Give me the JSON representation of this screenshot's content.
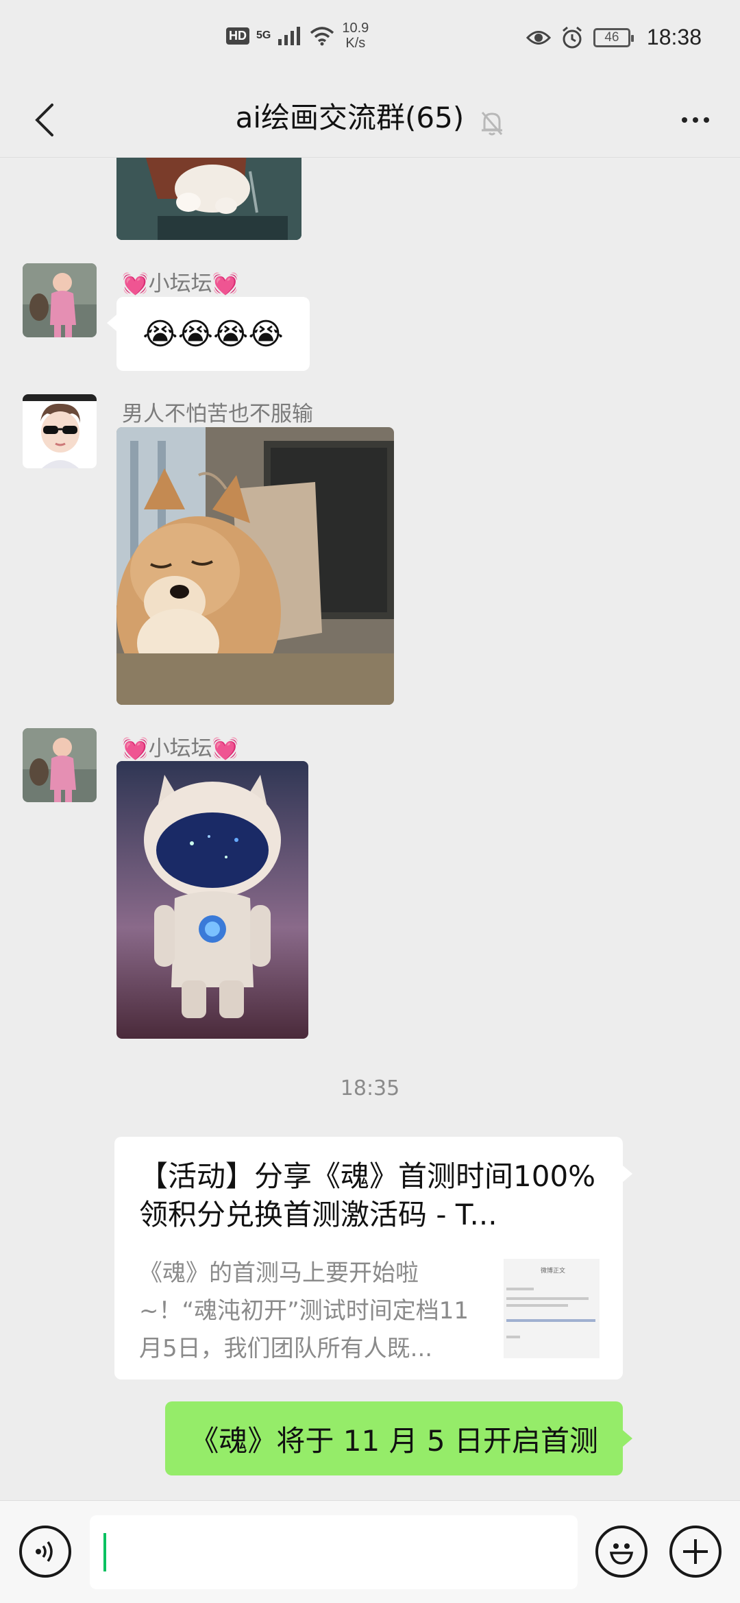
{
  "status_bar": {
    "hd_label": "HD",
    "network": "5G",
    "speed_value": "10.9",
    "speed_unit": "K/s",
    "battery": "46",
    "time": "18:38",
    "icons": [
      "eye-icon",
      "alarm-icon",
      "wifi-icon",
      "signal-icon",
      "battery-icon"
    ]
  },
  "header": {
    "title": "ai绘画交流群(65)",
    "muted": true
  },
  "messages": [
    {
      "type": "image",
      "sender": "",
      "description_icon": "cat-sticker"
    },
    {
      "type": "emoji",
      "sender": "💓小坛坛💓",
      "content": "😭😭😭😭"
    },
    {
      "type": "image",
      "sender": "男人不怕苦也不服输",
      "description_icon": "shiba-sticker"
    },
    {
      "type": "image",
      "sender": "💓小坛坛💓",
      "description_icon": "astronaut-image"
    }
  ],
  "timestamp": "18:35",
  "link_card": {
    "title": "【活动】分享《魂》首测时间100%领积分兑换首测激活码 - T...",
    "description": "《魂》的首测马上要开始啦~！“魂沌初开”测试时间定档11月5日，我们团队所有人既...",
    "thumb_label": "微博正文"
  },
  "my_message": "《魂》将于 11 月 5 日开启首测",
  "colors": {
    "bubble_green": "#95ec69",
    "background": "#ededed",
    "caret": "#07c160"
  }
}
